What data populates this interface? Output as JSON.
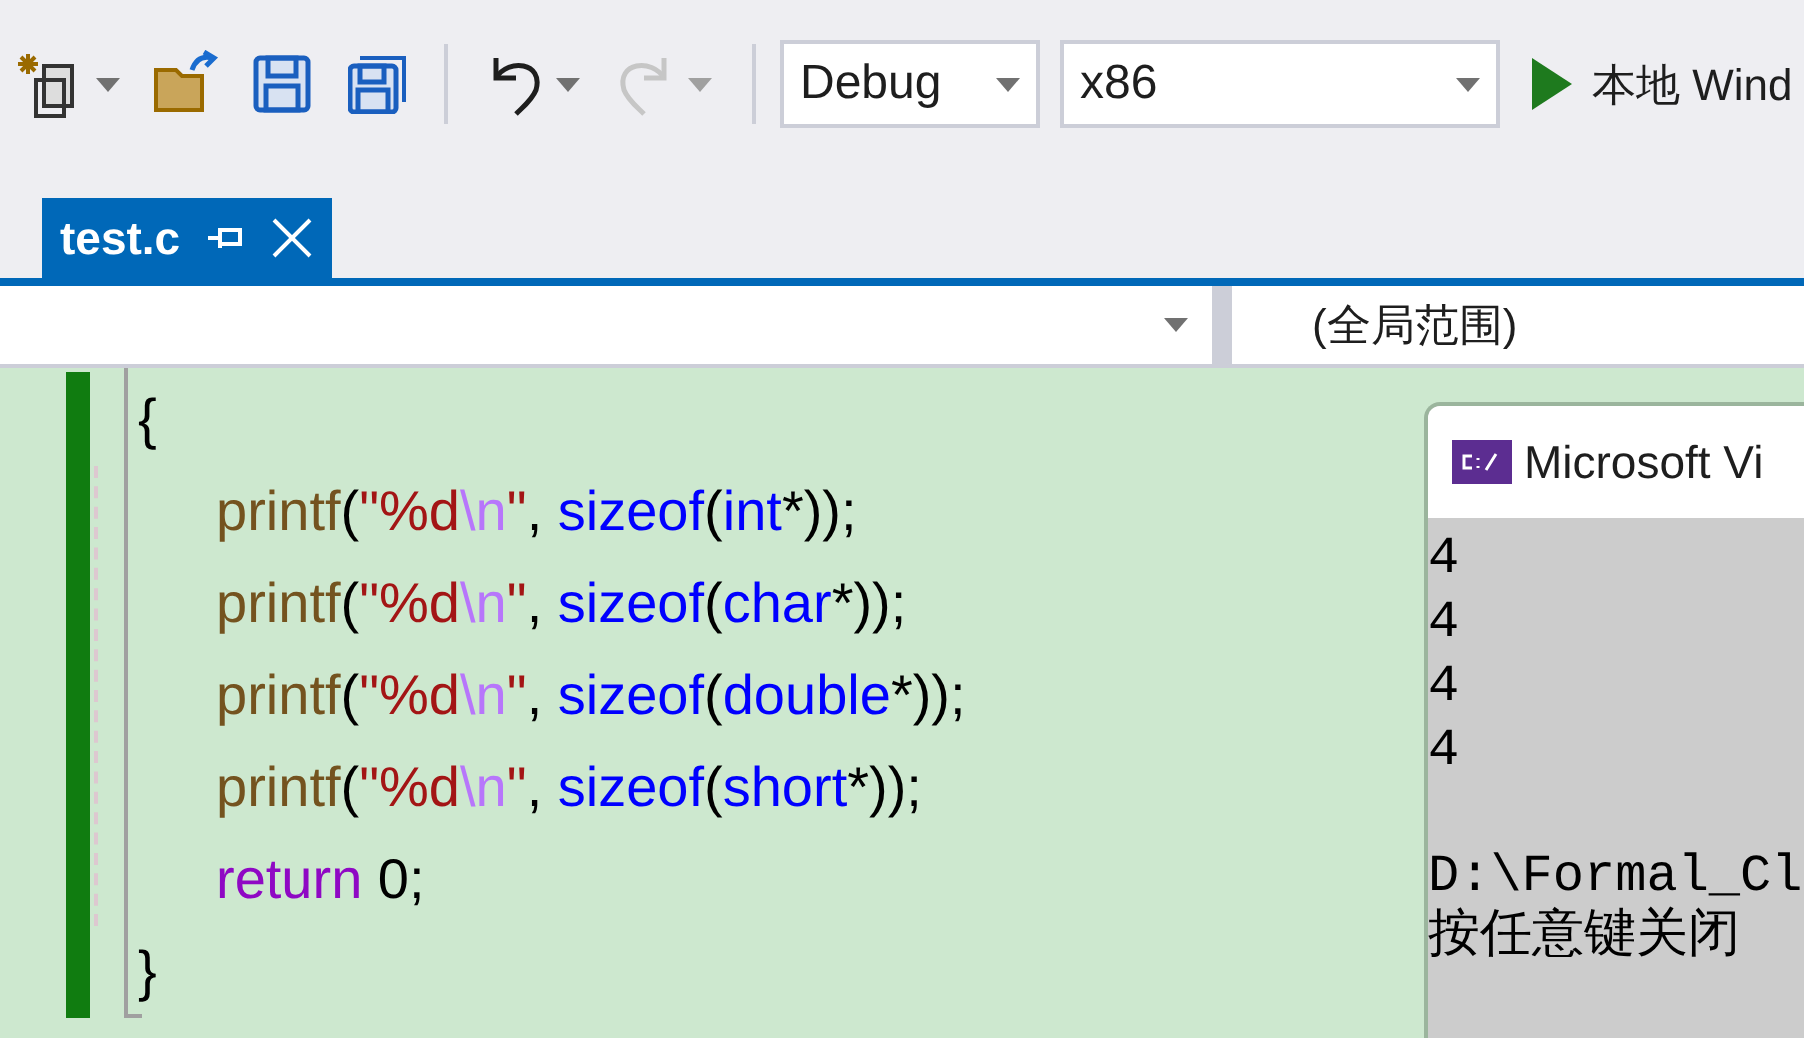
{
  "toolbar": {
    "configuration": "Debug",
    "platform": "x86",
    "run_button": "本地 Wind",
    "redo_disabled": true
  },
  "tabs": [
    {
      "label": "test.c",
      "selected": true
    }
  ],
  "navigation_bar": {
    "scope": "(全局范围)"
  },
  "editor": {
    "open_brace": "{",
    "close_brace": "}",
    "lines": [
      [
        {
          "text": "printf",
          "kind": "function"
        },
        {
          "text": "(",
          "kind": "punct"
        },
        {
          "text": "\"%d",
          "kind": "string"
        },
        {
          "text": "\\n",
          "kind": "escape"
        },
        {
          "text": "\"",
          "kind": "string"
        },
        {
          "text": ", ",
          "kind": "punct"
        },
        {
          "text": "sizeof",
          "kind": "keyword"
        },
        {
          "text": "(",
          "kind": "punct"
        },
        {
          "text": "int",
          "kind": "keyword"
        },
        {
          "text": "*));",
          "kind": "punct"
        }
      ],
      [
        {
          "text": "printf",
          "kind": "function"
        },
        {
          "text": "(",
          "kind": "punct"
        },
        {
          "text": "\"%d",
          "kind": "string"
        },
        {
          "text": "\\n",
          "kind": "escape"
        },
        {
          "text": "\"",
          "kind": "string"
        },
        {
          "text": ", ",
          "kind": "punct"
        },
        {
          "text": "sizeof",
          "kind": "keyword"
        },
        {
          "text": "(",
          "kind": "punct"
        },
        {
          "text": "char",
          "kind": "keyword"
        },
        {
          "text": "*));",
          "kind": "punct"
        }
      ],
      [
        {
          "text": "printf",
          "kind": "function"
        },
        {
          "text": "(",
          "kind": "punct"
        },
        {
          "text": "\"%d",
          "kind": "string"
        },
        {
          "text": "\\n",
          "kind": "escape"
        },
        {
          "text": "\"",
          "kind": "string"
        },
        {
          "text": ", ",
          "kind": "punct"
        },
        {
          "text": "sizeof",
          "kind": "keyword"
        },
        {
          "text": "(",
          "kind": "punct"
        },
        {
          "text": "double",
          "kind": "keyword"
        },
        {
          "text": "*));",
          "kind": "punct"
        }
      ],
      [
        {
          "text": "printf",
          "kind": "function"
        },
        {
          "text": "(",
          "kind": "punct"
        },
        {
          "text": "\"%d",
          "kind": "string"
        },
        {
          "text": "\\n",
          "kind": "escape"
        },
        {
          "text": "\"",
          "kind": "string"
        },
        {
          "text": ", ",
          "kind": "punct"
        },
        {
          "text": "sizeof",
          "kind": "keyword"
        },
        {
          "text": "(",
          "kind": "punct"
        },
        {
          "text": "short",
          "kind": "keyword"
        },
        {
          "text": "*));",
          "kind": "punct"
        }
      ],
      [
        {
          "text": "return",
          "kind": "control"
        },
        {
          "text": " 0;",
          "kind": "punct"
        }
      ]
    ]
  },
  "console": {
    "title": "Microsoft Vi",
    "output": [
      "4",
      "4",
      "4",
      "4"
    ],
    "footer": [
      "D:\\Formal_Cl",
      "按任意键关闭"
    ]
  }
}
